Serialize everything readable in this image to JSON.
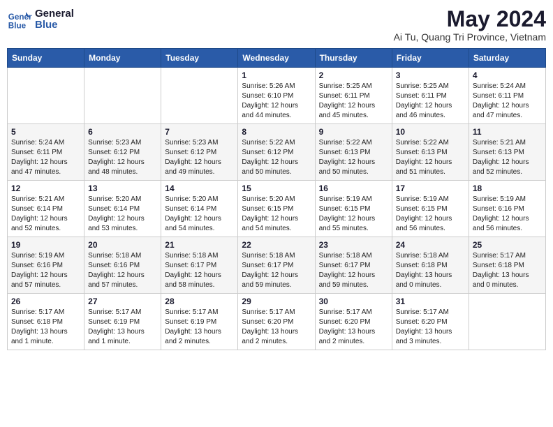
{
  "logo": {
    "text_general": "General",
    "text_blue": "Blue"
  },
  "header": {
    "title": "May 2024",
    "subtitle": "Ai Tu, Quang Tri Province, Vietnam"
  },
  "days_of_week": [
    "Sunday",
    "Monday",
    "Tuesday",
    "Wednesday",
    "Thursday",
    "Friday",
    "Saturday"
  ],
  "weeks": [
    [
      {
        "day": "",
        "info": ""
      },
      {
        "day": "",
        "info": ""
      },
      {
        "day": "",
        "info": ""
      },
      {
        "day": "1",
        "info": "Sunrise: 5:26 AM\nSunset: 6:10 PM\nDaylight: 12 hours\nand 44 minutes."
      },
      {
        "day": "2",
        "info": "Sunrise: 5:25 AM\nSunset: 6:11 PM\nDaylight: 12 hours\nand 45 minutes."
      },
      {
        "day": "3",
        "info": "Sunrise: 5:25 AM\nSunset: 6:11 PM\nDaylight: 12 hours\nand 46 minutes."
      },
      {
        "day": "4",
        "info": "Sunrise: 5:24 AM\nSunset: 6:11 PM\nDaylight: 12 hours\nand 47 minutes."
      }
    ],
    [
      {
        "day": "5",
        "info": "Sunrise: 5:24 AM\nSunset: 6:11 PM\nDaylight: 12 hours\nand 47 minutes."
      },
      {
        "day": "6",
        "info": "Sunrise: 5:23 AM\nSunset: 6:12 PM\nDaylight: 12 hours\nand 48 minutes."
      },
      {
        "day": "7",
        "info": "Sunrise: 5:23 AM\nSunset: 6:12 PM\nDaylight: 12 hours\nand 49 minutes."
      },
      {
        "day": "8",
        "info": "Sunrise: 5:22 AM\nSunset: 6:12 PM\nDaylight: 12 hours\nand 50 minutes."
      },
      {
        "day": "9",
        "info": "Sunrise: 5:22 AM\nSunset: 6:13 PM\nDaylight: 12 hours\nand 50 minutes."
      },
      {
        "day": "10",
        "info": "Sunrise: 5:22 AM\nSunset: 6:13 PM\nDaylight: 12 hours\nand 51 minutes."
      },
      {
        "day": "11",
        "info": "Sunrise: 5:21 AM\nSunset: 6:13 PM\nDaylight: 12 hours\nand 52 minutes."
      }
    ],
    [
      {
        "day": "12",
        "info": "Sunrise: 5:21 AM\nSunset: 6:14 PM\nDaylight: 12 hours\nand 52 minutes."
      },
      {
        "day": "13",
        "info": "Sunrise: 5:20 AM\nSunset: 6:14 PM\nDaylight: 12 hours\nand 53 minutes."
      },
      {
        "day": "14",
        "info": "Sunrise: 5:20 AM\nSunset: 6:14 PM\nDaylight: 12 hours\nand 54 minutes."
      },
      {
        "day": "15",
        "info": "Sunrise: 5:20 AM\nSunset: 6:15 PM\nDaylight: 12 hours\nand 54 minutes."
      },
      {
        "day": "16",
        "info": "Sunrise: 5:19 AM\nSunset: 6:15 PM\nDaylight: 12 hours\nand 55 minutes."
      },
      {
        "day": "17",
        "info": "Sunrise: 5:19 AM\nSunset: 6:15 PM\nDaylight: 12 hours\nand 56 minutes."
      },
      {
        "day": "18",
        "info": "Sunrise: 5:19 AM\nSunset: 6:16 PM\nDaylight: 12 hours\nand 56 minutes."
      }
    ],
    [
      {
        "day": "19",
        "info": "Sunrise: 5:19 AM\nSunset: 6:16 PM\nDaylight: 12 hours\nand 57 minutes."
      },
      {
        "day": "20",
        "info": "Sunrise: 5:18 AM\nSunset: 6:16 PM\nDaylight: 12 hours\nand 57 minutes."
      },
      {
        "day": "21",
        "info": "Sunrise: 5:18 AM\nSunset: 6:17 PM\nDaylight: 12 hours\nand 58 minutes."
      },
      {
        "day": "22",
        "info": "Sunrise: 5:18 AM\nSunset: 6:17 PM\nDaylight: 12 hours\nand 59 minutes."
      },
      {
        "day": "23",
        "info": "Sunrise: 5:18 AM\nSunset: 6:17 PM\nDaylight: 12 hours\nand 59 minutes."
      },
      {
        "day": "24",
        "info": "Sunrise: 5:18 AM\nSunset: 6:18 PM\nDaylight: 13 hours\nand 0 minutes."
      },
      {
        "day": "25",
        "info": "Sunrise: 5:17 AM\nSunset: 6:18 PM\nDaylight: 13 hours\nand 0 minutes."
      }
    ],
    [
      {
        "day": "26",
        "info": "Sunrise: 5:17 AM\nSunset: 6:18 PM\nDaylight: 13 hours\nand 1 minute."
      },
      {
        "day": "27",
        "info": "Sunrise: 5:17 AM\nSunset: 6:19 PM\nDaylight: 13 hours\nand 1 minute."
      },
      {
        "day": "28",
        "info": "Sunrise: 5:17 AM\nSunset: 6:19 PM\nDaylight: 13 hours\nand 2 minutes."
      },
      {
        "day": "29",
        "info": "Sunrise: 5:17 AM\nSunset: 6:20 PM\nDaylight: 13 hours\nand 2 minutes."
      },
      {
        "day": "30",
        "info": "Sunrise: 5:17 AM\nSunset: 6:20 PM\nDaylight: 13 hours\nand 2 minutes."
      },
      {
        "day": "31",
        "info": "Sunrise: 5:17 AM\nSunset: 6:20 PM\nDaylight: 13 hours\nand 3 minutes."
      },
      {
        "day": "",
        "info": ""
      }
    ]
  ]
}
